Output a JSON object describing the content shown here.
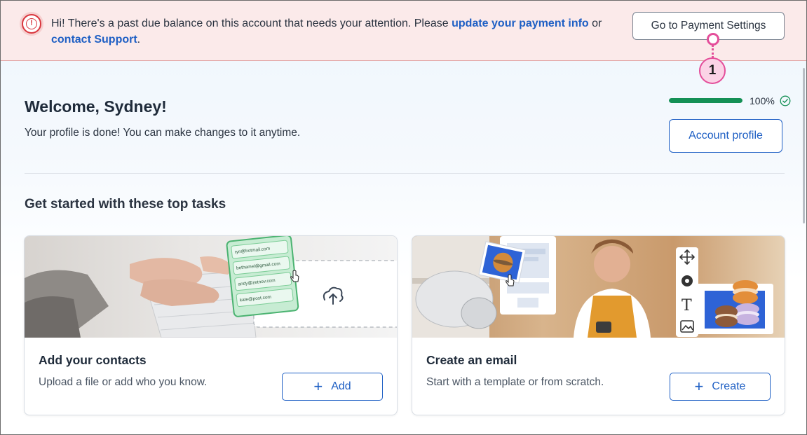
{
  "alert": {
    "message_part1": "Hi! There's a past due balance on this account that needs your attention. Please ",
    "update_link": "update your payment info",
    "message_part2": " or ",
    "support_link": "contact Support",
    "message_part3": ".",
    "button_label": "Go to Payment Settings",
    "icon": "alert-circle-icon",
    "color": "#d9363e"
  },
  "annotation": {
    "number": "1",
    "color": "#e44e9a"
  },
  "welcome": {
    "title": "Welcome, Sydney!",
    "subtitle": "Your profile is done! You can make changes to it anytime.",
    "progress_value": 100,
    "progress_label": "100%",
    "progress_color": "#149055",
    "profile_button": "Account profile"
  },
  "tasks": {
    "heading": "Get started with these top tasks",
    "cards": [
      {
        "title": "Add your contacts",
        "description": "Upload a file or add who you know.",
        "button": "Add",
        "contacts": [
          "ryn@hotmail.com",
          "bethamel@gmail.com",
          "andy@zetnov.com",
          "kate@post.com"
        ]
      },
      {
        "title": "Create an email",
        "description": "Start with a template or from scratch.",
        "button": "Create"
      }
    ]
  },
  "colors": {
    "accent": "#1e5fc4",
    "alert_bg": "#fbeaea"
  }
}
